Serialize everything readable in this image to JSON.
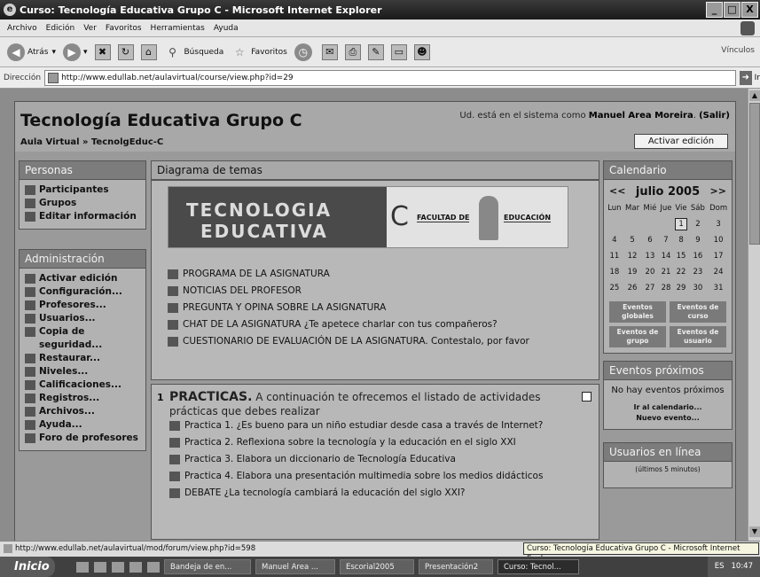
{
  "window": {
    "title": "Curso: Tecnología Educativa Grupo C - Microsoft Internet Explorer"
  },
  "menu": [
    "Archivo",
    "Edición",
    "Ver",
    "Favoritos",
    "Herramientas",
    "Ayuda"
  ],
  "toolbar": {
    "back": "Atrás",
    "search": "Búsqueda",
    "favorites": "Favoritos",
    "links": "Vínculos"
  },
  "address": {
    "label": "Dirección",
    "url": "http://www.edullab.net/aulavirtual/course/view.php?id=29",
    "go": "Ir"
  },
  "header": {
    "course_title": "Tecnología Educativa Grupo C",
    "logged_prefix": "Ud. está en el sistema como",
    "user": "Manuel Area Moreira",
    "logout": "(Salir)",
    "breadcrumb": "Aula Virtual » TecnolgEduc-C",
    "edit_button": "Activar edición"
  },
  "personas": {
    "title": "Personas",
    "items": [
      "Participantes",
      "Grupos",
      "Editar información"
    ]
  },
  "admin": {
    "title": "Administración",
    "items": [
      "Activar edición",
      "Configuración...",
      "Profesores...",
      "Usuarios...",
      "Copia de seguridad...",
      "Restaurar...",
      "Niveles...",
      "Calificaciones...",
      "Registros...",
      "Archivos...",
      "Ayuda...",
      "Foro de profesores"
    ]
  },
  "center": {
    "title": "Diagrama de temas",
    "banner": {
      "line1": "TECNOLOGIA",
      "line2": "EDUCATIVA",
      "letter": "C",
      "faculty": "FACULTAD DE",
      "education": "EDUCACIÓN"
    },
    "section0_links": [
      "PROGRAMA DE LA ASIGNATURA",
      "NOTICIAS DEL PROFESOR",
      "PREGUNTA Y OPINA SOBRE LA ASIGNATURA",
      "CHAT DE LA ASIGNATURA ¿Te apetece charlar con tus compañeros?",
      "CUESTIONARIO DE EVALUACIÓN DE LA ASIGNATURA. Contestalo, por favor"
    ],
    "section1": {
      "number": "1",
      "heading": "PRACTICAS.",
      "intro_line1": "A continuación te ofrecemos el listado de actividades",
      "intro_line2": "prácticas que debes realizar",
      "links": [
        "Practica 1. ¿Es bueno para un niño estudiar desde casa a través de Internet?",
        "Practica 2. Reflexiona sobre la tecnología y la educación en el siglo XXI",
        "Practica 3. Elabora un diccionario de Tecnología Educativa",
        "Practica 4. Elabora una presentación multimedia sobre los medios didácticos",
        "DEBATE ¿La tecnología cambiará la educación del siglo XXI?"
      ]
    }
  },
  "calendar": {
    "title": "Calendario",
    "prev": "<<",
    "month": "julio 2005",
    "next": ">>",
    "weekdays": [
      "Lun",
      "Mar",
      "Mié",
      "Jue",
      "Vie",
      "Sáb",
      "Dom"
    ],
    "weeks": [
      [
        "",
        "",
        "",
        "",
        "1",
        "2",
        "3"
      ],
      [
        "4",
        "5",
        "6",
        "7",
        "8",
        "9",
        "10"
      ],
      [
        "11",
        "12",
        "13",
        "14",
        "15",
        "16",
        "17"
      ],
      [
        "18",
        "19",
        "20",
        "21",
        "22",
        "23",
        "24"
      ],
      [
        "25",
        "26",
        "27",
        "28",
        "29",
        "30",
        "31"
      ]
    ],
    "today": "1",
    "legend": [
      "Eventos globales",
      "Eventos de curso",
      "Eventos de grupo",
      "Eventos de usuario"
    ]
  },
  "events": {
    "title": "Eventos próximos",
    "none": "No hay eventos próximos",
    "calendar_link": "Ir al calendario...",
    "new_event": "Nuevo evento..."
  },
  "online": {
    "title": "Usuarios en línea",
    "subtitle": "(últimos 5 minutos)"
  },
  "status": {
    "url": "http://www.edullab.net/aulavirtual/mod/forum/view.php?id=598",
    "tooltip": "Curso: Tecnología Educativa Grupo C - Microsoft Internet Explorer"
  },
  "taskbar": {
    "start": "Inicio",
    "tasks": [
      "Bandeja de en...",
      "Manuel Area ...",
      "Escorial2005",
      "Presentación2",
      "Curso: Tecnol..."
    ],
    "lang": "ES",
    "clock": "10:47"
  }
}
